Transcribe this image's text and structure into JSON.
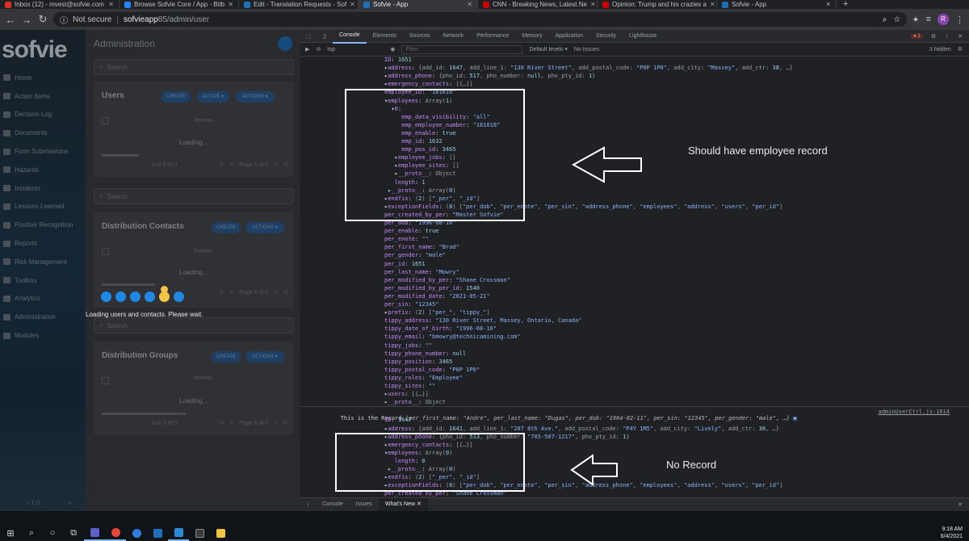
{
  "tabs": [
    {
      "title": "Inbox (12) - mvest@sofvie.com"
    },
    {
      "title": "Browse Sofvie Core / App - Bitb"
    },
    {
      "title": "Edit - Translation Requests - Sof"
    },
    {
      "title": "Sofvie - App"
    },
    {
      "title": "CNN - Breaking News, Latest Ne"
    },
    {
      "title": "Opinion: Trump and his crazies a"
    },
    {
      "title": "Sofvie - App"
    }
  ],
  "url": {
    "security": "Not secure",
    "host": "sofvieapp",
    "rest": "85/admin/user",
    "profile": "R"
  },
  "app": {
    "logo": "sofvie",
    "title": "Administration",
    "nav": [
      "Home",
      "Action Items",
      "Decision Log",
      "Documents",
      "Form Submissions",
      "Hazards",
      "Incidents",
      "Lessons Learned",
      "Positive Recognition",
      "Reports",
      "Risk Management",
      "Toolbox",
      "Analytics",
      "Administration",
      "Modules"
    ],
    "version": "v 1.0",
    "collapse": "«",
    "search_placeholder": "Search",
    "users": {
      "title": "Users",
      "create": "CREATE",
      "active": "ACTIVE ▾",
      "actions": "ACTIONS ▾",
      "review": "Review",
      "loading": "Loading...",
      "count": "0 to 0 of 0",
      "page": "Page 0 of 0"
    },
    "contacts": {
      "title": "Distribution Contacts",
      "create": "CREATE",
      "actions": "ACTIONS ▾",
      "review": "Review",
      "loading": "Loading...",
      "page": "Page 0 of 0"
    },
    "groups": {
      "title": "Distribution Groups",
      "create": "CREATE",
      "actions": "ACTIONS ▾",
      "review": "Review",
      "loading": "Loading...",
      "count": "0 to 0 of 0",
      "page": "Page 0 of 0"
    },
    "loading_message": "Loading users and contacts. Please wait."
  },
  "devtools": {
    "tabs": [
      "Console",
      "Elements",
      "Sources",
      "Network",
      "Performance",
      "Memory",
      "Application",
      "Security",
      "Lighthouse"
    ],
    "errors": "1",
    "context": "top",
    "filter": "Filter",
    "levels": "Default levels ▾",
    "issues": "No Issues",
    "hidden": "3 hidden",
    "drawer": [
      "Console",
      "Issues",
      "What's New"
    ],
    "lines1": [
      "ID: 1651",
      "▸address: {add_id: 1647, add_line_1: \"130 River Street\", add_postal_code: \"P0P 1P0\", add_city: \"Massey\", add_ctr: 38, …}",
      "▸address_phone: {pho_id: 517, pho_number: null, pho_pty_id: 1}",
      "▸emergency_contacts: [{…}]",
      "employee_ID: \"181018\"",
      "▾employees: Array(1)",
      "  ▾0:",
      "     emp_data_visibility: \"all\"",
      "     emp_employee_number: \"181018\"",
      "     emp_enable: true",
      "     emp_id: 1632",
      "     emp_pos_id: 3465",
      "   ▸employee_jobs: []",
      "   ▸employee_sites: []",
      "   ▸__proto__: Object",
      "   length: 1",
      " ▸__proto__: Array(0)",
      "▸endfix: (2) [\"_per\", \"_id\"]",
      "▸exceptionFields: (8) [\"per_dob\", \"per_enote\", \"per_sin\", \"address_phone\", \"employees\", \"address\", \"users\", \"per_id\"]",
      "per_created_by_per: \"Master Sofvie\"",
      "per_dob: \"1996-08-16\"",
      "per_enable: true",
      "per_enote: \"\"",
      "per_first_name: \"Brad\"",
      "per_gender: \"male\"",
      "per_id: 1651",
      "per_last_name: \"Mowry\"",
      "per_modified_by_per: \"Shane Crossman\"",
      "per_modified_by_per_id: 1540",
      "per_modified_date: \"2021-05-21\"",
      "per_sin: \"12345\"",
      "▸prefix: (2) [\"per_\", \"tippy_\"]",
      "tippy_address: \"130 River Street, Massey, Ontario, Canada\"",
      "tippy_date_of_birth: \"1996-08-16\"",
      "tippy_email: \"bmowry@technicamining.com\"",
      "tippy_jobs: \"\"",
      "tippy_phone_number: null",
      "tippy_position: 3465",
      "tippy_postal_code: \"P0P 1P0\"",
      "tippy_roles: \"Employee\"",
      "tippy_sites: \"\"",
      "▸users: [{…}]",
      "▸__proto__: Object"
    ],
    "record_prefix": "This is the Record ",
    "record_summary": "{per_first_name: \"Andre\", per_last_name: \"Dugas\", per_dob: \"1964-02-11\", per_sin: \"12345\", per_gender: \"male\", …}",
    "record_source": "adminUserCtrl.js:1614",
    "lines2": [
      "ID: 1647",
      "▸address: {add_id: 1641, add_line_1: \"207 8th Ave.\", add_postal_code: \"P4Y 1M5\", add_city: \"Lively\", add_ctr: 38, …}",
      "▸address_phone: {pho_id: 513, pho_number: \"705-507-1217\", pho_pty_id: 1}",
      "▸emergency_contacts: [{…}]",
      "▾employees: Array(0)",
      "   length: 0",
      " ▸__proto__: Array(0)",
      "▸endfix: (2) [\"_per\", \"_id\"]",
      "▸exceptionFields: (8) [\"per_dob\", \"per_enote\", \"per_sin\", \"address_phone\", \"employees\", \"address\", \"users\", \"per_id\"]",
      "per_created_by_per: \"Shane Crossman\"",
      "per_dob: \"1964-02-11\""
    ],
    "annotation_top": "Should have employee record",
    "annotation_bottom": "No Record"
  },
  "taskbar": {
    "time": "9:18 AM",
    "date": "6/4/2021"
  }
}
